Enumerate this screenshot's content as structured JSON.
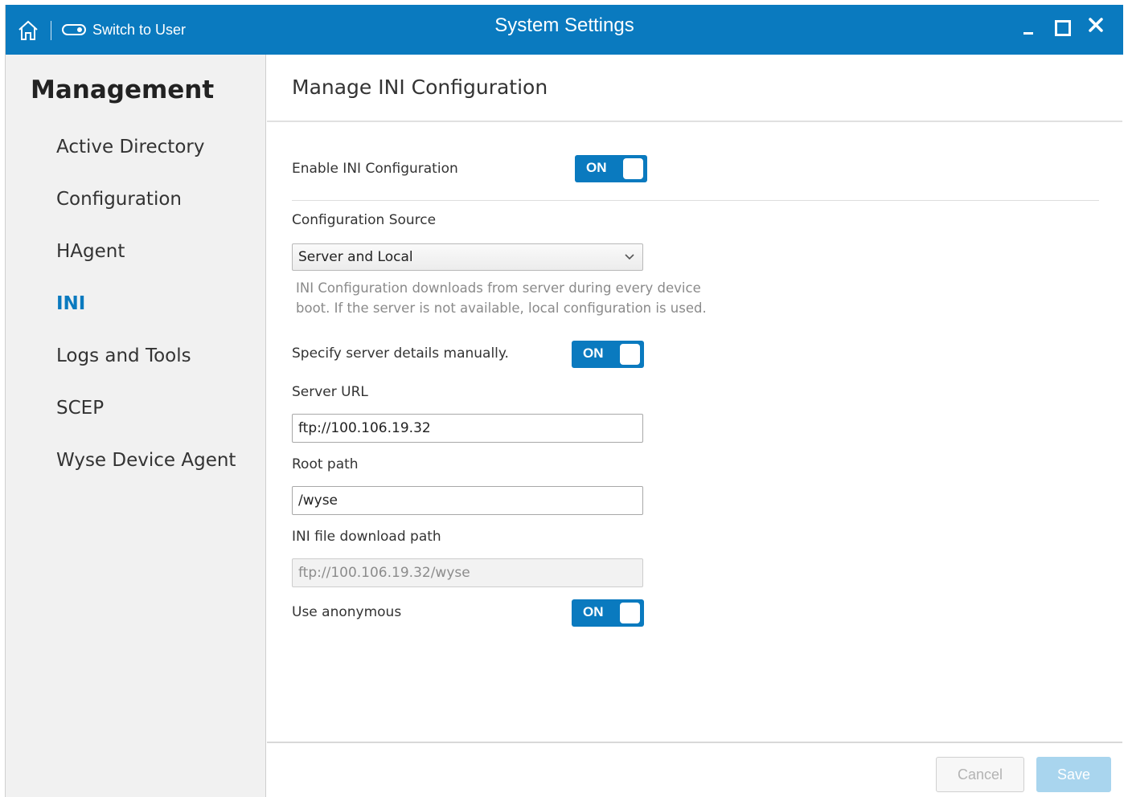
{
  "titlebar": {
    "switch_label": "Switch to User",
    "title": "System Settings"
  },
  "sidebar": {
    "title": "Management",
    "items": [
      {
        "label": "Active Directory",
        "active": false
      },
      {
        "label": "Configuration",
        "active": false
      },
      {
        "label": "HAgent",
        "active": false
      },
      {
        "label": "INI",
        "active": true
      },
      {
        "label": "Logs and Tools",
        "active": false
      },
      {
        "label": "SCEP",
        "active": false
      },
      {
        "label": "Wyse Device Agent",
        "active": false
      }
    ]
  },
  "main": {
    "title": "Manage INI Configuration",
    "enable_ini": {
      "label": "Enable INI Configuration",
      "state": "ON"
    },
    "config_source": {
      "label": "Configuration Source",
      "selected": "Server and Local",
      "help": "INI Configuration downloads from server during every device boot. If the server is not available, local configuration is used."
    },
    "manual_server": {
      "label": "Specify server details manually.",
      "state": "ON"
    },
    "server_url": {
      "label": "Server URL",
      "value": "ftp://100.106.19.32"
    },
    "root_path": {
      "label": "Root path",
      "value": "/wyse"
    },
    "download_path": {
      "label": "INI file download path",
      "value": "ftp://100.106.19.32/wyse"
    },
    "anonymous": {
      "label": "Use anonymous",
      "state": "ON"
    }
  },
  "footer": {
    "cancel_label": "Cancel",
    "save_label": "Save"
  },
  "colors": {
    "accent": "#0a7abf",
    "save_disabled": "#a9d5ee"
  }
}
